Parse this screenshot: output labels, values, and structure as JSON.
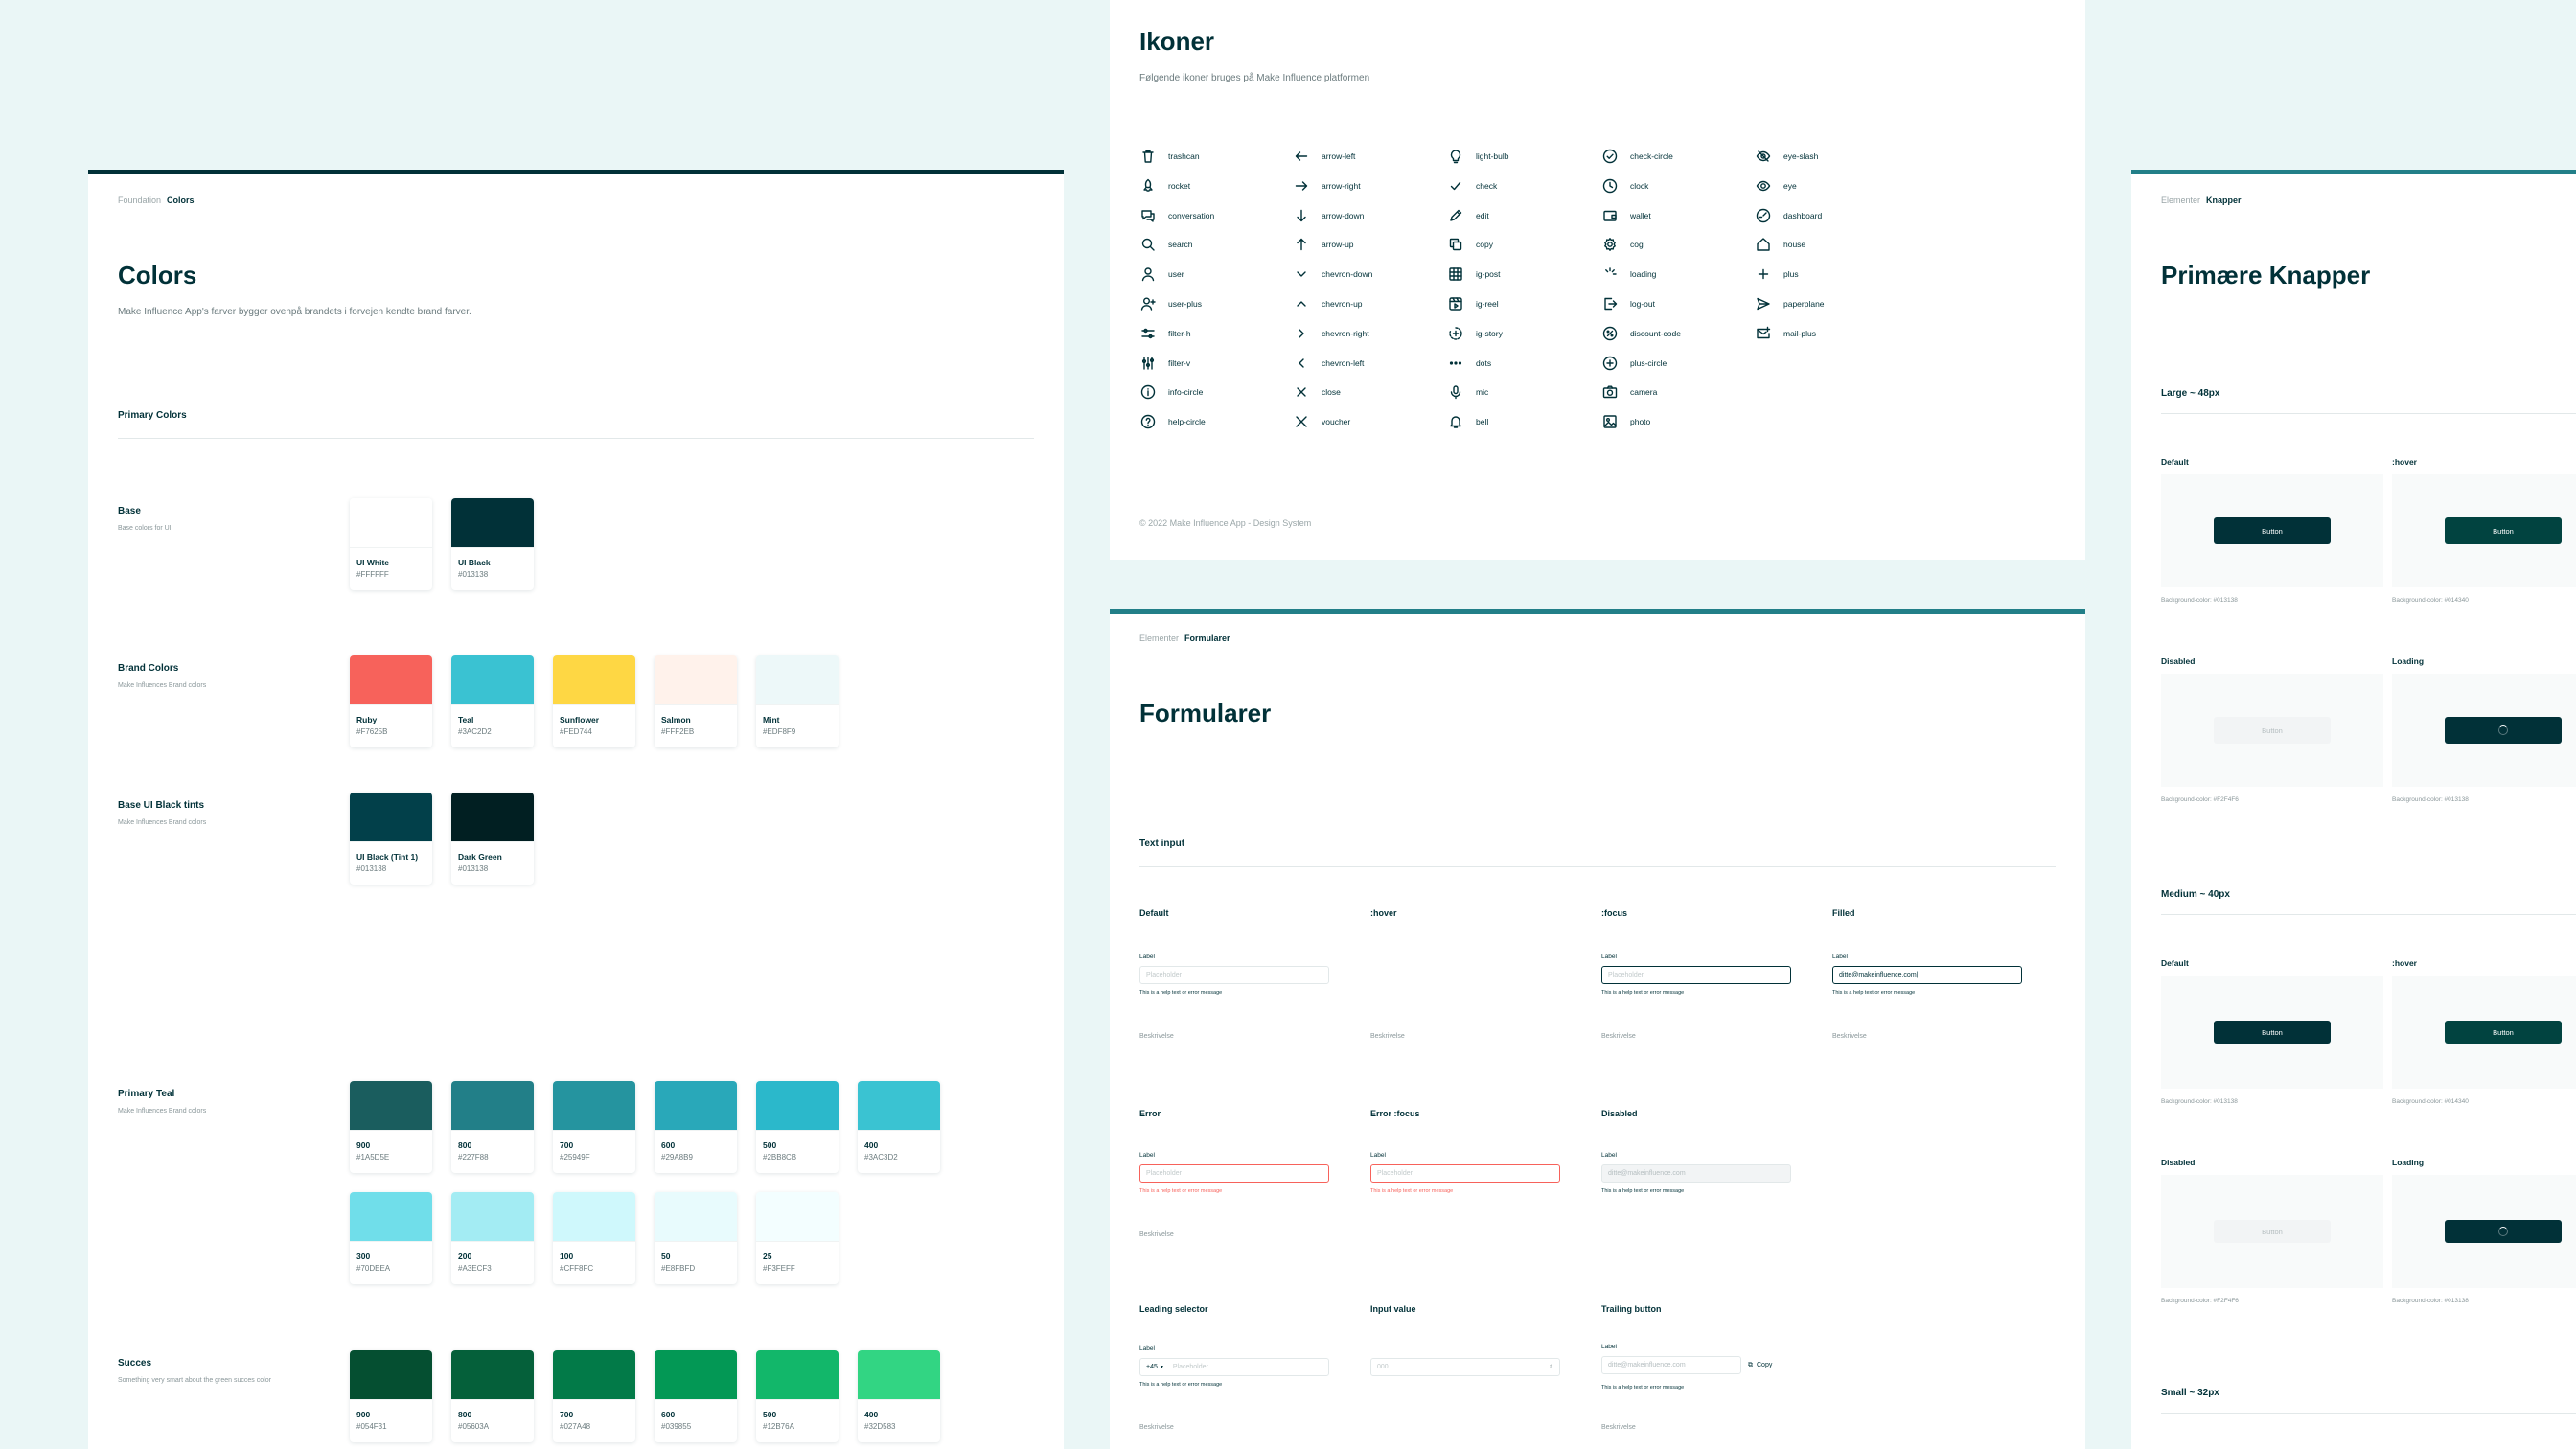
{
  "colors_page": {
    "breadcrumb": {
      "parent": "Foundation",
      "current": "Colors"
    },
    "title": "Colors",
    "description": "Make Influence App's farver bygger ovenpå brandets i forvejen kendte brand farver.",
    "section_title": "Primary Colors",
    "groups": [
      {
        "title": "Base",
        "sub": "Base colors for UI",
        "rows": [
          [
            {
              "name": "UI White",
              "hex": "#FFFFFF",
              "color": "#FFFFFF"
            },
            {
              "name": "UI Black",
              "hex": "#013138",
              "color": "#013138"
            }
          ]
        ]
      },
      {
        "title": "Brand Colors",
        "sub": "Make Influences Brand colors",
        "rows": [
          [
            {
              "name": "Ruby",
              "hex": "#F7625B",
              "color": "#F7625B"
            },
            {
              "name": "Teal",
              "hex": "#3AC2D2",
              "color": "#3AC2D2"
            },
            {
              "name": "Sunflower",
              "hex": "#FED744",
              "color": "#FED744"
            },
            {
              "name": "Salmon",
              "hex": "#FFF2EB",
              "color": "#FFF2EB"
            },
            {
              "name": "Mint",
              "hex": "#EDF8F9",
              "color": "#EDF8F9"
            }
          ]
        ]
      },
      {
        "title": "Base UI Black tints",
        "sub": "Make Influences Brand colors",
        "rows": [
          [
            {
              "name": "UI Black (Tint 1)",
              "hex": "#013138",
              "color": "#02404A"
            },
            {
              "name": "Dark Green",
              "hex": "#013138",
              "color": "#011F22"
            }
          ]
        ]
      },
      {
        "title": "Primary Teal",
        "sub": "Make Influences Brand colors",
        "rows": [
          [
            {
              "name": "900",
              "hex": "#1A5D5E",
              "color": "#1A5D5E"
            },
            {
              "name": "800",
              "hex": "#227F88",
              "color": "#227F88"
            },
            {
              "name": "700",
              "hex": "#25949F",
              "color": "#25949F"
            },
            {
              "name": "600",
              "hex": "#29A8B9",
              "color": "#29A8B9"
            },
            {
              "name": "500",
              "hex": "#2BB8CB",
              "color": "#2BB8CB"
            },
            {
              "name": "400",
              "hex": "#3AC3D2",
              "color": "#3AC3D2"
            }
          ],
          [
            {
              "name": "300",
              "hex": "#70DEEA",
              "color": "#70DEEA"
            },
            {
              "name": "200",
              "hex": "#A3ECF3",
              "color": "#A3ECF3"
            },
            {
              "name": "100",
              "hex": "#CFF8FC",
              "color": "#CFF8FC"
            },
            {
              "name": "50",
              "hex": "#E8FBFD",
              "color": "#E8FBFD"
            },
            {
              "name": "25",
              "hex": "#F3FEFF",
              "color": "#F3FEFF"
            }
          ]
        ]
      },
      {
        "title": "Succes",
        "sub": "Something very smart about the green succes color",
        "rows": [
          [
            {
              "name": "900",
              "hex": "#054F31",
              "color": "#054F31"
            },
            {
              "name": "800",
              "hex": "#05603A",
              "color": "#05603A"
            },
            {
              "name": "700",
              "hex": "#027A48",
              "color": "#027A48"
            },
            {
              "name": "600",
              "hex": "#039855",
              "color": "#039855"
            },
            {
              "name": "500",
              "hex": "#12B76A",
              "color": "#12B76A"
            },
            {
              "name": "400",
              "hex": "#32D583",
              "color": "#32D583"
            }
          ]
        ]
      }
    ]
  },
  "icons_page": {
    "title": "Ikoner",
    "description": "Følgende ikoner bruges på Make Influence platformen",
    "columns": [
      [
        "trashcan",
        "rocket",
        "conversation",
        "search",
        "user",
        "user-plus",
        "filter-h",
        "filter-v",
        "info-circle",
        "help-circle"
      ],
      [
        "arrow-left",
        "arrow-right",
        "arrow-down",
        "arrow-up",
        "chevron-down",
        "chevron-up",
        "chevron-right",
        "chevron-left",
        "close",
        "voucher"
      ],
      [
        "light-bulb",
        "check",
        "edit",
        "copy",
        "ig-post",
        "ig-reel",
        "ig-story",
        "dots",
        "mic",
        "bell"
      ],
      [
        "check-circle",
        "clock",
        "wallet",
        "cog",
        "loading",
        "log-out",
        "discount-code",
        "plus-circle",
        "camera",
        "photo"
      ],
      [
        "eye-slash",
        "eye",
        "dashboard",
        "house",
        "plus",
        "paperplane",
        "mail-plus"
      ]
    ],
    "footer": "© 2022 Make Influence App - Design System"
  },
  "forms_page": {
    "breadcrumb": {
      "parent": "Elementer",
      "current": "Formularer"
    },
    "title": "Formularer",
    "section_title": "Text input",
    "label": "Label",
    "placeholder": "Placeholder",
    "help_text": "This is a help text or error message",
    "description": "Beskrivelse",
    "filled_value": "ditte@makeinfluence.com|",
    "disabled_value": "ditte@makeinfluence.com",
    "row1": [
      "Default",
      ":hover",
      ":focus",
      "Filled"
    ],
    "row2": [
      "Error",
      "Error :focus",
      "Disabled"
    ],
    "row3": [
      "Leading selector",
      "Input value",
      "Trailing button"
    ],
    "leading_prefix": "+45",
    "input_value_text": "000",
    "trailing_button": "Copy"
  },
  "buttons_page": {
    "breadcrumb": {
      "parent": "Elementer",
      "current": "Knapper"
    },
    "title": "Primære Knapper",
    "button_label": "Button",
    "sizes": [
      {
        "title": "Large ~ 48px"
      },
      {
        "title": "Medium ~ 40px"
      },
      {
        "title": "Small ~ 32px"
      }
    ],
    "states": [
      "Default",
      ":hover",
      "Disabled",
      "Loading"
    ],
    "bg_notes": [
      "Background-color: #013138",
      "Background-color: #014340",
      "Background-color: #F2F4F6",
      "Background-color: #013138"
    ]
  }
}
